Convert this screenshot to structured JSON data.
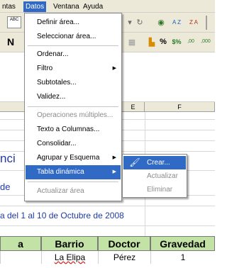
{
  "menubar": {
    "items": [
      {
        "label": "ntas"
      },
      {
        "label": "Datos"
      },
      {
        "label": "Ventana"
      },
      {
        "label": "Ayuda"
      }
    ]
  },
  "toolbar": {
    "font_bold_label": "N",
    "spell_label": "ABC",
    "percent_label": "%",
    "currency_label": "$%",
    "decimal_add_label": ",00",
    "decimal_remove_label": ",000",
    "sort_asc_label": "A Z",
    "sort_desc_label": "Z A"
  },
  "columns": {
    "e": "E",
    "f": "F"
  },
  "sheet": {
    "partial_text_1": "nci",
    "partial_text_2": "de",
    "date_text": "a del 1 al 10 de Octubre de 2008"
  },
  "datos_menu": {
    "items": [
      {
        "label": "Definir área...",
        "disabled": false,
        "submenu": false
      },
      {
        "label": "Seleccionar área...",
        "disabled": false,
        "submenu": false
      },
      {
        "label": "Ordenar...",
        "disabled": false,
        "submenu": false
      },
      {
        "label": "Filtro",
        "disabled": false,
        "submenu": true
      },
      {
        "label": "Subtotales...",
        "disabled": false,
        "submenu": false
      },
      {
        "label": "Validez...",
        "disabled": false,
        "submenu": false
      },
      {
        "label": "Operaciones múltiples...",
        "disabled": true,
        "submenu": false
      },
      {
        "label": "Texto a Columnas...",
        "disabled": false,
        "submenu": false
      },
      {
        "label": "Consolidar...",
        "disabled": false,
        "submenu": false
      },
      {
        "label": "Agrupar y Esquema",
        "disabled": false,
        "submenu": true
      },
      {
        "label": "Tabla dinámica",
        "disabled": false,
        "submenu": true,
        "highlighted": true
      },
      {
        "label": "Actualizar área",
        "disabled": true,
        "submenu": false
      }
    ]
  },
  "tabla_dinamica_submenu": {
    "items": [
      {
        "label": "Crear...",
        "disabled": false,
        "highlighted": true
      },
      {
        "label": "Actualizar",
        "disabled": true
      },
      {
        "label": "Eliminar",
        "disabled": true
      }
    ]
  },
  "table": {
    "headers": [
      "a",
      "Barrio",
      "Doctor",
      "Gravedad"
    ],
    "rows": [
      [
        "",
        "La Elipa",
        "Pérez",
        "1"
      ]
    ]
  },
  "colors": {
    "menu_highlight": "#316ac5",
    "table_header_bg": "#c3e3a6",
    "sheet_text_blue": "#1f3aa8",
    "chrome_bg": "#ece9d8"
  }
}
